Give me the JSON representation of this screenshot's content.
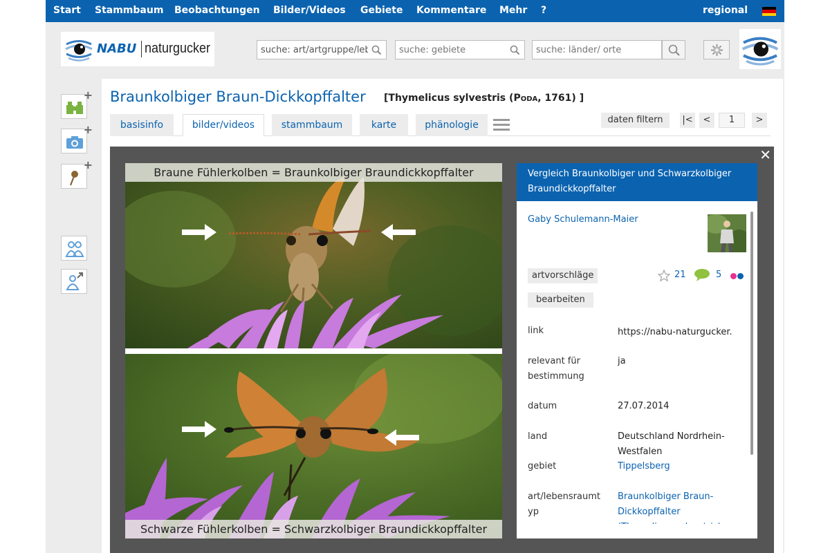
{
  "nav": {
    "items": [
      "Start",
      "Stammbaum",
      "Beobachtungen",
      "Bilder/Videos",
      "Gebiete",
      "Kommentare",
      "Mehr",
      "?"
    ],
    "regional": "regional",
    "flag_colors": [
      "#000000",
      "#dd0000",
      "#ffce00"
    ]
  },
  "header": {
    "logo_nabu": "NABU",
    "logo_naturgucker": "naturgucker",
    "search_art": "suche: art/artgruppe/lebensraum",
    "search_gebiete": "suche: gebiete",
    "search_laender": "suche: länder/ orte"
  },
  "species": {
    "title": "Braunkolbiger Braun-Dickkopffalter",
    "sci_open": "[",
    "sci_name": "Thymelicus sylvestris",
    "sci_paren_open": "(",
    "sci_author": "Poda",
    "sci_year": ", 1761)",
    "sci_close": "]"
  },
  "tabs": [
    "basisinfo",
    "bilder/videos",
    "stammbaum",
    "karte",
    "phänologie"
  ],
  "active_tab": "bilder/videos",
  "pager": {
    "filter": "daten filtern",
    "first": "|<",
    "prev": "<",
    "page": "1",
    "next": ">"
  },
  "photo": {
    "caption_top": "Braune Fühlerkolben = Braunkolbiger Braundickkopffalter",
    "caption_bottom": "Schwarze Fühlerkolben = Schwarzkolbiger Braundickkopffalter"
  },
  "info": {
    "heading": "Vergleich Braunkolbiger und Schwarzkolbiger Braundickkopffalter",
    "author": "Gaby Schulemann-Maier",
    "artvorschlaege": "artvorschläge",
    "bearbeiten": "bearbeiten",
    "stars": "21",
    "comments": "5",
    "dot_colors": [
      "#e8318f",
      "#0b63b0"
    ],
    "rows": [
      {
        "label": "link",
        "value": "https://nabu-naturgucker.de"
      },
      {
        "label": "relevant für bestimmung",
        "value": "ja"
      },
      {
        "label": "datum",
        "value": "27.07.2014"
      },
      {
        "label": "land",
        "value": "Deutschland Nordrhein-Westfalen"
      },
      {
        "label": "gebiet",
        "value": "Tippelsberg"
      },
      {
        "label": "art/lebensraumtyp",
        "value": "Braunkolbiger Braun-Dickkopffalter (Thymelicus sylvestris)"
      }
    ]
  },
  "accent": "#0b63b0"
}
